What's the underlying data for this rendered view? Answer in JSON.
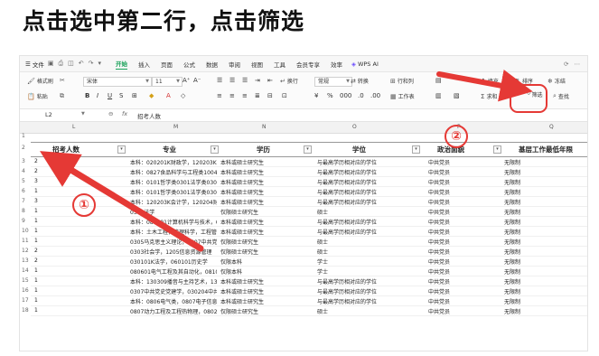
{
  "heading": "点击选中第二行，点击筛选",
  "menubar": {
    "file": "文件",
    "tabs": [
      "开始",
      "插入",
      "页面",
      "公式",
      "数据",
      "审阅",
      "视图",
      "工具",
      "会员专享",
      "效率"
    ],
    "active_tab": "开始",
    "wps_ai": "WPS AI"
  },
  "ribbon": {
    "format_painter": "格式刷",
    "paste": "粘贴",
    "font": "宋体",
    "font_size": "11",
    "wrap": "换行",
    "number_format": "常规",
    "convert": "转换",
    "row_col": "行和列",
    "worksheet": "工作表",
    "fill": "填充",
    "sort": "排序",
    "sum": "求和",
    "filter": "筛选",
    "find": "查找",
    "freeze": "冻结"
  },
  "formula_bar": {
    "cell_ref": "L2",
    "content": "招考人数"
  },
  "columns": [
    "L",
    "M",
    "N",
    "O",
    "P",
    "Q"
  ],
  "row_numbers": [
    "1",
    "2",
    "3",
    "4",
    "5",
    "6",
    "7",
    "8",
    "9",
    "10",
    "11",
    "12",
    "13",
    "14",
    "15",
    "16",
    "17",
    "18"
  ],
  "header": {
    "zhaokao": "招考人数",
    "zhuanye": "专业",
    "xueli": "学历",
    "xuewei": "学位",
    "zhengzhi": "政治面貌",
    "jiceng": "基层工作最低年限"
  },
  "rows": [
    [
      "2",
      "本科：020201K财政学，120203K会",
      "本科或硕士研究生",
      "与最高学历相对应的学位",
      "中共党员",
      "无限制"
    ],
    [
      "2",
      "本科：0827食品科学与工程类100402",
      "本科或硕士研究生",
      "与最高学历相对应的学位",
      "中共党员",
      "无限制"
    ],
    [
      "3",
      "本科：0101哲学类0301法学类0302",
      "本科或硕士研究生",
      "与最高学历相对应的学位",
      "中共党员",
      "无限制"
    ],
    [
      "1",
      "本科：0101哲学类0301法学类0302",
      "本科或硕士研究生",
      "与最高学历相对应的学位",
      "中共党员",
      "无限制"
    ],
    [
      "3",
      "本科：120203K会计学，120204财务",
      "本科或硕士研究生",
      "与最高学历相对应的学位",
      "中共党员",
      "无限制"
    ],
    [
      "1",
      "0301法学",
      "仅限硕士研究生",
      "硕士",
      "中共党员",
      "无限制"
    ],
    [
      "1",
      "本科：080901计算机科学与技术，0",
      "本科或硕士研究生",
      "与最高学历相对应的学位",
      "中共党员",
      "无限制"
    ],
    [
      "1",
      "本科：土木工程，管理科学，工程管理",
      "本科或硕士研究生",
      "与最高学历相对应的学位",
      "中共党员",
      "无限制"
    ],
    [
      "1",
      "0305马克思主义理论，0307中共党史",
      "仅限硕士研究生",
      "硕士",
      "中共党员",
      "无限制"
    ],
    [
      "2",
      "0303社会学，1205信息资源管理",
      "仅限硕士研究生",
      "硕士",
      "中共党员",
      "无限制"
    ],
    [
      "2",
      "030101K法学，060101历史学",
      "仅限本科",
      "学士",
      "中共党员",
      "无限制"
    ],
    [
      "1",
      "080601电气工程及其自动化，08100",
      "仅限本科",
      "学士",
      "中共党员",
      "无限制"
    ],
    [
      "1",
      "本科：130309播音与主持艺术，130",
      "本科或硕士研究生",
      "与最高学历相对应的学位",
      "中共党员",
      "无限制"
    ],
    [
      "1",
      "0307中共党史党建学，030204中共",
      "本科或硕士研究生",
      "与最高学历相对应的学位",
      "中共党员",
      "无限制"
    ],
    [
      "1",
      "本科：0806电气类，0807电子信息类",
      "本科或硕士研究生",
      "与最高学历相对应的学位",
      "中共党员",
      "无限制"
    ],
    [
      "1",
      "0807动力工程及工程热物理，08020",
      "仅限硕士研究生",
      "硕士",
      "中共党员",
      "无限制"
    ]
  ],
  "annotations": {
    "step1": "①",
    "step2": "②"
  },
  "colors": {
    "accent_green": "#1aa25a",
    "annotation_red": "#e53935"
  }
}
